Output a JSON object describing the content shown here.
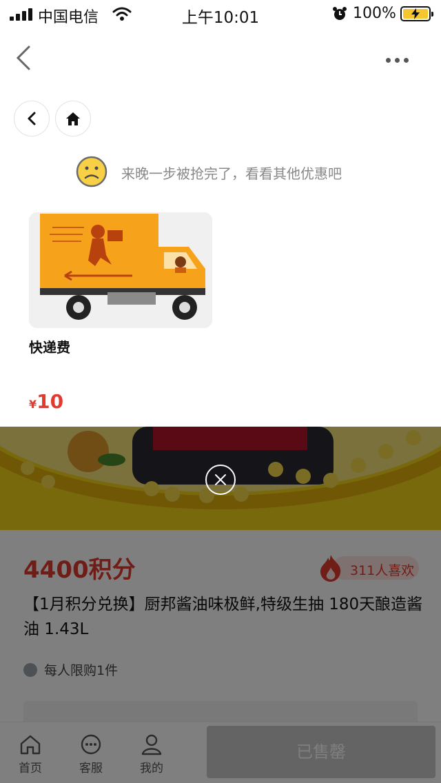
{
  "status_bar": {
    "carrier": "中国电信",
    "time": "上午10:01",
    "battery": "100%"
  },
  "popup": {
    "notice": "来晚一步被抢完了，看看其他优惠吧",
    "coupon": {
      "name": "快递费",
      "currency": "¥",
      "price": "10"
    }
  },
  "product": {
    "points": "4400积分",
    "likes": "311人喜欢",
    "title": "【1月积分兑换】厨邦酱油味极鲜,特级生抽 180天酿造酱油 1.43L",
    "limit": "每人限购1件"
  },
  "bottom_bar": {
    "home": "首页",
    "service": "客服",
    "mine": "我的",
    "sold_out": "已售罄"
  },
  "colors": {
    "accent_red": "#e23a2e",
    "truck_orange": "#f7a21b",
    "banner_yellow": "#f2d21a"
  }
}
